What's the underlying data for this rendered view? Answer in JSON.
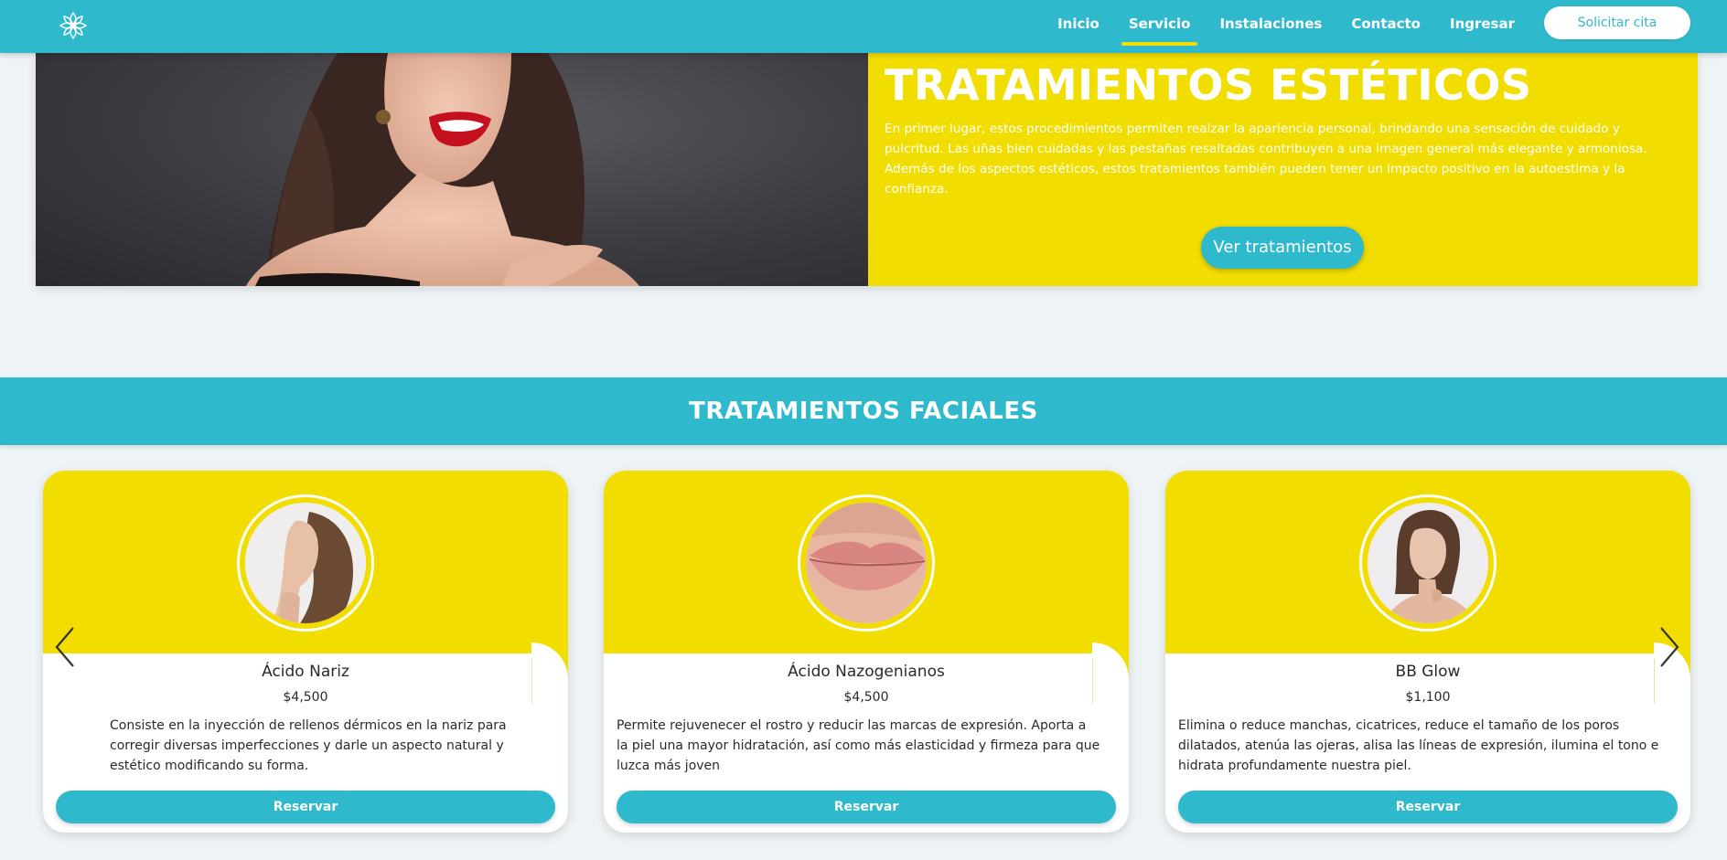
{
  "nav": {
    "logo_icon": "lotus-flower-icon",
    "links": [
      "Inicio",
      "Servicio",
      "Instalaciones",
      "Contacto",
      "Ingresar"
    ],
    "active_link": "Servicio",
    "cta_label": "Solicitar cita"
  },
  "hero": {
    "title": "TRATAMIENTOS ESTÉTICOS",
    "text": "En primer lugar, estos procedimientos permiten realzar la apariencia personal, brindando una sensación de cuidado y pulcritud. Las uñas bien cuidadas y las pestañas resaltadas contribuyen a una imagen general más elegante y armoniosa. Además de los aspectos estéticos, estos tratamientos también pueden tener un impacto positivo en la autoestima y la confianza.",
    "button_label": "Ver tratamientos"
  },
  "section": {
    "title": "TRATAMIENTOS FACIALES"
  },
  "cards": [
    {
      "name": "Ácido Nariz",
      "price": "$4,500",
      "description": "Consiste en la inyección de rellenos dérmicos en la nariz para corregir diversas imperfecciones y darle un aspecto natural y estético modificando su forma.",
      "button_label": "Reservar"
    },
    {
      "name": "Ácido Nazogenianos",
      "price": "$4,500",
      "description": "Permite rejuvenecer el rostro y reducir las marcas de expresión. Aporta a la piel una mayor hidratación, así como más elasticidad y firmeza para que luzca más joven",
      "button_label": "Reservar"
    },
    {
      "name": "BB Glow",
      "price": "$1,100",
      "description": "Elimina o reduce manchas, cicatrices, reduce el tamaño de los poros dilatados, atenúa las ojeras, alisa las líneas de expresión, ilumina el tono e hidrata profundamente nuestra piel.",
      "button_label": "Reservar"
    }
  ],
  "carousel": {
    "prev_icon": "chevron-left-icon",
    "next_icon": "chevron-right-icon"
  },
  "colors": {
    "primary": "#2fb9cd",
    "accent": "#f2dd00",
    "background": "#eef4f6"
  }
}
